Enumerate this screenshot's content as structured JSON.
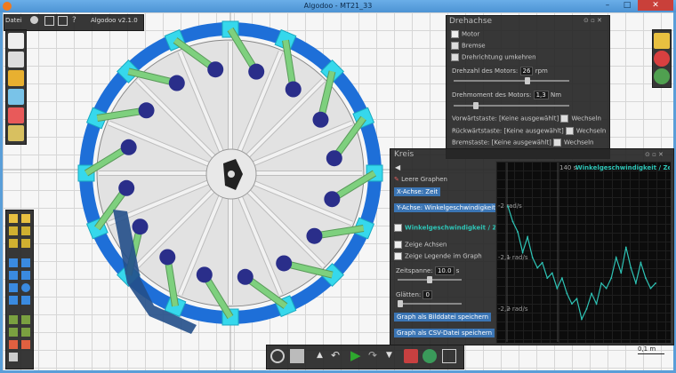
{
  "window": {
    "title": "Algodoo - MT21_33",
    "minimize": "–",
    "maximize": "□",
    "close": "✕"
  },
  "toolbar": {
    "menu_label": "Datei",
    "version": "Algodoo v2.1.0",
    "help": "?"
  },
  "drehachse": {
    "title": "Drehachse",
    "motor_label": "Motor",
    "motor_checked": true,
    "bremse_label": "Bremse",
    "bremse_checked": false,
    "umkehren_label": "Drehrichtung umkehren",
    "umkehren_checked": false,
    "drehzahl_label": "Drehzahl des Motors:",
    "drehzahl_value": "26",
    "drehzahl_unit": "rpm",
    "drehmoment_label": "Drehmoment des Motors:",
    "drehmoment_value": "1,3",
    "drehmoment_unit": "Nm",
    "keys": [
      {
        "label": "Vorwärtstaste:",
        "value": "[Keine ausgewählt]",
        "toggle": "Wechseln"
      },
      {
        "label": "Rückwärtstaste:",
        "value": "[Keine ausgewählt]",
        "toggle": "Wechseln"
      },
      {
        "label": "Bremstaste:",
        "value": "[Keine ausgewählt]",
        "toggle": "Wechseln"
      }
    ]
  },
  "kreis": {
    "title": "Kreis",
    "clear_graphs": "Leere Graphen",
    "x_axis_button": "X-Achse: Zeit",
    "y_axis_button": "Y-Achse: Winkelgeschwindigkeit",
    "graph_toggle_label": "Winkelgeschwindigkeit / Zeit",
    "show_axes_label": "Zeige Achsen",
    "show_legend_label": "Zeige Legende im Graph",
    "timespan_label": "Zeitspanne:",
    "timespan_value": "10.0",
    "timespan_unit": "s",
    "smooth_label": "Glätten:",
    "smooth_value": "0",
    "save_image_button": "Graph als Bilddatei speichern",
    "save_csv_button": "Graph als CSV-Datei speichern"
  },
  "chart_data": {
    "type": "line",
    "title": "Winkelgeschwindigkeit / Zeit",
    "xlabel": "",
    "ylabel": "",
    "x_tick_label": "140 s",
    "y_tick_labels": [
      "-2 rad/s",
      "-2,1 rad/s",
      "-2,2 rad/s"
    ],
    "ylim": [
      -2.24,
      -1.96
    ],
    "series": [
      {
        "color": "#2ec4b6",
        "x": [
          136.0,
          136.3,
          136.6,
          136.9,
          137.2,
          137.5,
          137.8,
          138.1,
          138.4,
          138.7,
          139.0,
          139.3,
          139.6,
          139.9,
          140.2,
          140.5,
          140.8,
          141.1,
          141.4,
          141.7,
          142.0,
          142.3,
          142.6,
          142.9,
          143.2,
          143.5,
          143.8,
          144.1,
          144.4,
          144.7,
          145.0
        ],
        "values": [
          -2.0,
          -2.03,
          -2.05,
          -2.09,
          -2.06,
          -2.1,
          -2.12,
          -2.11,
          -2.14,
          -2.13,
          -2.16,
          -2.14,
          -2.17,
          -2.19,
          -2.18,
          -2.22,
          -2.2,
          -2.17,
          -2.19,
          -2.15,
          -2.16,
          -2.14,
          -2.1,
          -2.13,
          -2.08,
          -2.12,
          -2.15,
          -2.11,
          -2.14,
          -2.16,
          -2.15
        ]
      }
    ]
  },
  "scale_label": "0,1 m",
  "colors": {
    "accent": "#3b75b4",
    "rim": "#1e6fd8",
    "segments": "#36d8ec",
    "spokes": "#7ed07e",
    "nodes": "#2a2e8a",
    "graph_line": "#2ec4b6"
  }
}
